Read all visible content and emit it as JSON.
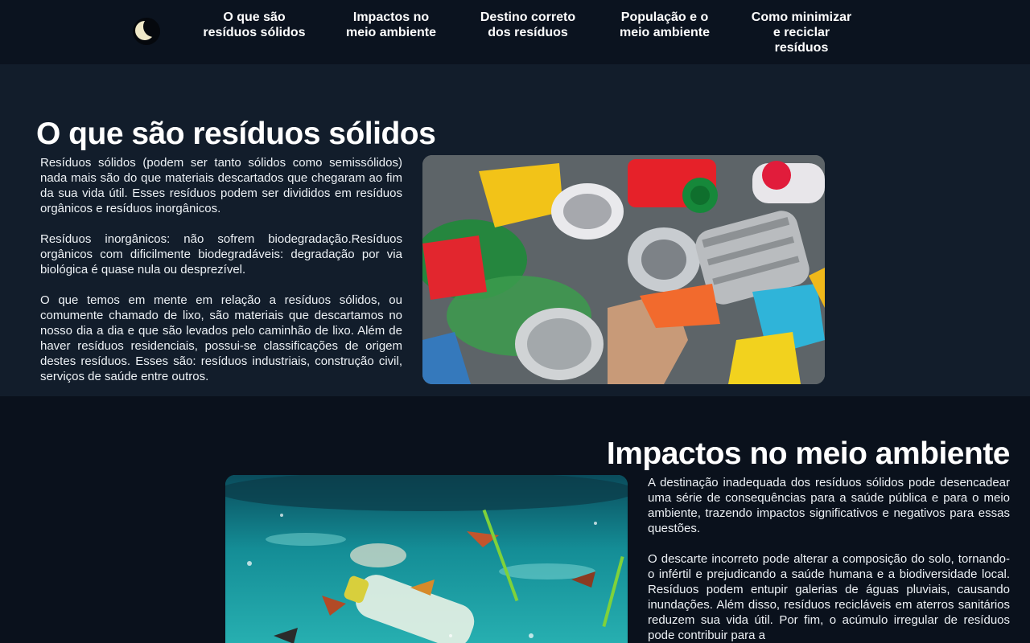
{
  "nav": {
    "logo_icon": "moon-icon",
    "items": [
      {
        "label": "O que são\nresíduos sólidos"
      },
      {
        "label": "Impactos no\nmeio ambiente"
      },
      {
        "label": "Destino correto\ndos resíduos"
      },
      {
        "label": "População e o\nmeio ambiente"
      },
      {
        "label": "Como minimizar\ne reciclar\nresíduos"
      }
    ]
  },
  "section1": {
    "title": "O que são resíduos sólidos",
    "paragraphs": [
      "Resíduos sólidos (podem ser tanto sólidos como semissólidos) nada mais são do que materiais descartados que chegaram ao fim da sua vida útil. Esses resíduos podem ser divididos em resíduos orgânicos e resíduos inorgânicos.",
      "Resíduos inorgânicos: não sofrem biodegradação.Resíduos orgânicos com dificilmente biodegradáveis: degradação por via biológica é quase nula ou desprezível.",
      "O que temos em mente em relação a resíduos sólidos, ou comumente chamado de lixo, são materiais que descartamos no nosso dia a dia e que são levados pelo caminhão de lixo. Além de haver resíduos residenciais, possui-se classificações de origem destes resíduos. Esses são: resíduos industriais, construção civil, serviços de saúde entre outros."
    ]
  },
  "section2": {
    "title": "Impactos no meio ambiente",
    "paragraphs": [
      "A destinação inadequada dos resíduos sólidos pode desencadear uma série de consequências para a saúde pública e para o meio ambiente, trazendo impactos significativos e negativos para essas questões.",
      "O descarte incorreto pode alterar a composição do solo, tornando-o infértil e prejudicando a saúde humana e a biodiversidade local. Resíduos podem entupir galerias de águas pluviais, causando inundações. Além disso, resíduos recicláveis em aterros sanitários reduzem sua vida útil. Por fim, o acúmulo irregular de resíduos pode contribuir para a"
    ]
  },
  "colors": {
    "nav_bg": "#0b131f",
    "section1_bg": "#121d2b",
    "page_bg": "#0a111c",
    "text": "#eef2f6"
  }
}
